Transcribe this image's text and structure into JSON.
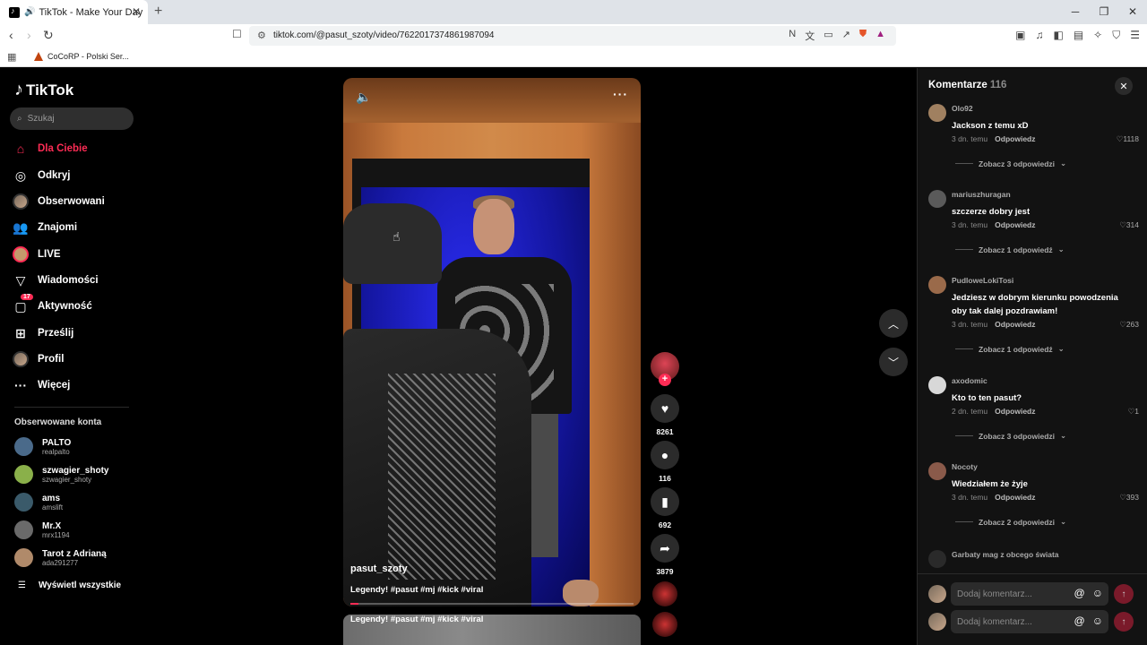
{
  "browser": {
    "tab_title": "TikTok - Make Your Day",
    "url": "tiktok.com/@pasut_szoty/video/7622017374861987094",
    "bookmark": "CoCoRP - Polski Ser..."
  },
  "sidebar": {
    "logo": "TikTok",
    "search_placeholder": "Szukaj",
    "nav": [
      {
        "label": "Dla Ciebie",
        "icon": "home-icon"
      },
      {
        "label": "Odkryj",
        "icon": "compass-icon"
      },
      {
        "label": "Obserwowani",
        "icon": "following-avatar-icon"
      },
      {
        "label": "Znajomi",
        "icon": "friends-icon"
      },
      {
        "label": "LIVE",
        "icon": "live-icon"
      },
      {
        "label": "Wiadomości",
        "icon": "send-icon"
      },
      {
        "label": "Aktywność",
        "icon": "inbox-icon",
        "badge": "17"
      },
      {
        "label": "Prześlij",
        "icon": "upload-icon"
      },
      {
        "label": "Profil",
        "icon": "profile-icon"
      },
      {
        "label": "Więcej",
        "icon": "more-icon"
      }
    ],
    "followed_title": "Obserwowane konta",
    "accounts": [
      {
        "name": "PALTO",
        "handle": "realpalto",
        "color": "#4a6a8a"
      },
      {
        "name": "szwagier_shoty",
        "handle": "szwagier_shoty",
        "color": "#8ab04a"
      },
      {
        "name": "ams",
        "handle": "amslift",
        "color": "#3a5a6a"
      },
      {
        "name": "Mr.X",
        "handle": "mrx1194",
        "color": "#6a6a6a"
      },
      {
        "name": "Tarot z Adrianą",
        "handle": "ada291277",
        "color": "#b08a6a"
      }
    ],
    "show_all": "Wyświetl wszystkie"
  },
  "video": {
    "username": "pasut_szoty",
    "caption": "Legendy! #pasut #mj #kick #viral",
    "progress": 0.03,
    "next_caption": "Legendy! #pasut #mj #kick #viral"
  },
  "actions": {
    "likes": "8261",
    "comments": "116",
    "saves": "692",
    "shares": "3879"
  },
  "comments": {
    "title": "Komentarze",
    "count": "116",
    "reply_label": "Odpowiedz",
    "items": [
      {
        "user": "Olo92",
        "text": "Jackson z temu xD",
        "time": "3 dn. temu",
        "likes": "1118",
        "more": "Zobacz 3 odpowiedzi",
        "color": "#a08060"
      },
      {
        "user": "mariuszhuragan",
        "text": "szczerze dobry jest",
        "time": "3 dn. temu",
        "likes": "314",
        "more": "Zobacz 1 odpowiedź",
        "color": "#5a5a5a"
      },
      {
        "user": "PudloweLokiTosi",
        "text": "Jedziesz w dobrym kierunku powodzenia oby tak dalej pozdrawiam!",
        "time": "3 dn. temu",
        "likes": "263",
        "more": "Zobacz 1 odpowiedź",
        "color": "#9a6a4a"
      },
      {
        "user": "axodomic",
        "text": "Kto to ten pasut?",
        "time": "2 dn. temu",
        "likes": "1",
        "more": "Zobacz 3 odpowiedzi",
        "color": "#d8d8d8"
      },
      {
        "user": "Nocoty",
        "text": "Wiedziałem że żyje",
        "time": "3 dn. temu",
        "likes": "393",
        "more": "Zobacz 2 odpowiedzi",
        "color": "#8a5a4a"
      }
    ],
    "partial_user": "Garbaty mag z obcego świata",
    "input_placeholder": "Dodaj komentarz..."
  }
}
